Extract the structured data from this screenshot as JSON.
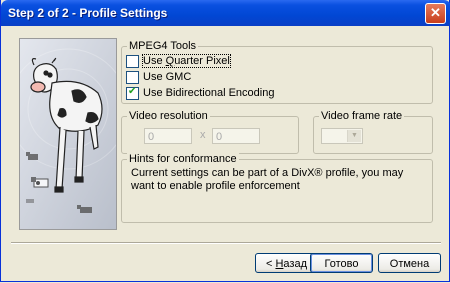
{
  "window": {
    "title": "Step 2 of 2 - Profile Settings",
    "close_glyph": "✕"
  },
  "mpeg4_tools": {
    "legend": "MPEG4 Tools",
    "options": [
      {
        "label": "Use Quarter Pixel",
        "checked": false
      },
      {
        "label": "Use GMC",
        "checked": false
      },
      {
        "label": "Use Bidirectional Encoding",
        "checked": true
      }
    ]
  },
  "video_resolution": {
    "legend": "Video resolution",
    "width": "0",
    "height": "0",
    "separator": "x"
  },
  "video_frame_rate": {
    "legend": "Video frame rate",
    "selected": ""
  },
  "hints": {
    "legend": "Hints for conformance",
    "text": "Current settings can be part of a DivX® profile, you may want to enable profile enforcement"
  },
  "buttons": {
    "back": "< Назад",
    "finish": "Готово",
    "cancel": "Отмена"
  },
  "icons": {
    "close": "close-icon",
    "illustration": "cow-illustration",
    "dropdown": "chevron-down-icon"
  },
  "colors": {
    "titlebar": "#0147d4",
    "dialog_bg": "#ece9d8",
    "check_mark": "#21a121"
  }
}
